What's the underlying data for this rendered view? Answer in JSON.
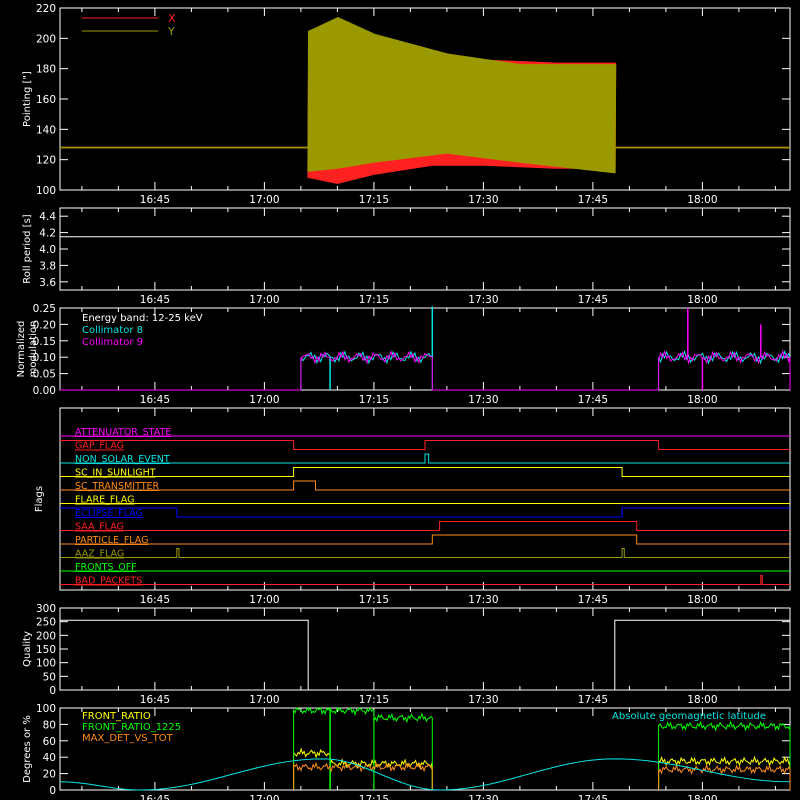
{
  "time_ticks": [
    "16:45",
    "17:00",
    "17:15",
    "17:30",
    "17:45",
    "18:00"
  ],
  "colors": {
    "background": "#000000",
    "axis": "#ffffff",
    "red": "#ff2020",
    "olive": "#9a9a00",
    "cyan": "#00e5e5",
    "magenta": "#ff00ff",
    "green": "#00ff00",
    "yellow": "#ffff00",
    "orange": "#ff8c1a",
    "blue": "#0000ff"
  },
  "chart_data": [
    {
      "type": "line",
      "ylabel": "Pointing [\"]",
      "ylim": [
        100,
        220
      ],
      "yticks": [
        100,
        120,
        140,
        160,
        180,
        200,
        220
      ],
      "xlim": [
        "16:32",
        "18:12"
      ],
      "legend_position": "top-left",
      "series": [
        {
          "name": "X",
          "color": "red",
          "envelope": [
            [
              "16:32",
              128,
              128
            ],
            [
              "17:06",
              128,
              128
            ],
            [
              "17:06",
              108,
              182
            ],
            [
              "17:10",
              104,
              188
            ],
            [
              "17:15",
              110,
              190
            ],
            [
              "17:23",
              116,
              186
            ],
            [
              "17:30",
              116,
              186
            ],
            [
              "17:40",
              114,
              184
            ],
            [
              "17:48",
              114,
              184
            ],
            [
              "17:48",
              128,
              128
            ],
            [
              "18:12",
              128,
              128
            ]
          ]
        },
        {
          "name": "Y",
          "color": "olive",
          "envelope": [
            [
              "16:32",
              128,
              128
            ],
            [
              "17:06",
              128,
              128
            ],
            [
              "17:06",
              112,
              205
            ],
            [
              "17:10",
              114,
              214
            ],
            [
              "17:15",
              118,
              203
            ],
            [
              "17:25",
              124,
              190
            ],
            [
              "17:35",
              118,
              183
            ],
            [
              "17:48",
              111,
              183
            ],
            [
              "17:48",
              128,
              128
            ],
            [
              "18:12",
              128,
              128
            ]
          ]
        }
      ]
    },
    {
      "type": "line",
      "ylabel": "Roll period [s]",
      "ylim": [
        3.5,
        4.5
      ],
      "yticks": [
        3.6,
        3.8,
        4.0,
        4.2,
        4.4
      ],
      "series": [
        {
          "name": "",
          "color": "axis",
          "x": [
            "16:32",
            "18:12"
          ],
          "y": [
            4.15,
            4.15
          ]
        }
      ]
    },
    {
      "type": "line",
      "ylabel": "Normalized modulation",
      "ylim": [
        0.0,
        0.25
      ],
      "yticks": [
        0.0,
        0.05,
        0.1,
        0.15,
        0.2,
        0.25
      ],
      "annotation": "Energy band: 12-25 keV",
      "legend_position": "top-left",
      "series": [
        {
          "name": "Collimator 8",
          "color": "cyan",
          "segments": [
            [
              "17:05",
              "17:23",
              0.1
            ],
            [
              "17:54",
              "18:12",
              0.1
            ]
          ],
          "spikes": [
            [
              "17:09",
              0.0
            ],
            [
              "17:23",
              0.26
            ]
          ]
        },
        {
          "name": "Collimator 9",
          "color": "magenta",
          "segments": [
            [
              "17:05",
              "17:23",
              0.1
            ],
            [
              "17:54",
              "18:12",
              0.1
            ]
          ],
          "spikes": [
            [
              "17:58",
              0.25
            ],
            [
              "18:00",
              0.0
            ],
            [
              "18:08",
              0.2
            ]
          ]
        }
      ]
    },
    {
      "type": "line",
      "ylabel": "Flags",
      "series": [
        {
          "name": "ATTENUATOR_STATE",
          "color": "magenta",
          "steps": [
            [
              "16:32",
              0
            ],
            [
              "18:12",
              0
            ]
          ]
        },
        {
          "name": "SAA_FLAG_GAP_FLAG",
          "label": "GAP_FLAG",
          "color": "red",
          "steps": [
            [
              "16:32",
              1
            ],
            [
              "17:04",
              0
            ],
            [
              "17:22",
              1
            ],
            [
              "17:54",
              0
            ],
            [
              "18:12",
              0
            ]
          ]
        },
        {
          "name": "NON_SOLAR_EVENT",
          "color": "cyan",
          "steps": [
            [
              "16:32",
              0
            ],
            [
              "17:22",
              1
            ],
            [
              "17:22.5",
              0
            ],
            [
              "18:12",
              0
            ]
          ]
        },
        {
          "name": "SC_IN_SUNLIGHT",
          "color": "yellow",
          "steps": [
            [
              "16:32",
              0
            ],
            [
              "17:04",
              1
            ],
            [
              "17:49",
              0
            ],
            [
              "18:12",
              0
            ]
          ]
        },
        {
          "name": "SC_TRANSMITTER",
          "color": "orange",
          "steps": [
            [
              "16:32",
              0
            ],
            [
              "17:04",
              1
            ],
            [
              "17:07",
              0
            ],
            [
              "18:12",
              0
            ]
          ]
        },
        {
          "name": "FLARE_FLAG",
          "color": "yellow",
          "steps": [
            [
              "16:32",
              0
            ],
            [
              "18:12",
              0
            ]
          ]
        },
        {
          "name": "ECLIPSE_FLAG",
          "color": "blue",
          "steps": [
            [
              "16:32",
              1
            ],
            [
              "16:48",
              0
            ],
            [
              "17:49",
              1
            ],
            [
              "18:12",
              1
            ]
          ]
        },
        {
          "name": "SAA_FLAG",
          "color": "red",
          "steps": [
            [
              "16:32",
              0
            ],
            [
              "17:24",
              1
            ],
            [
              "17:51",
              0
            ],
            [
              "18:12",
              0
            ]
          ]
        },
        {
          "name": "PARTICLE_FLAG",
          "color": "orange",
          "steps": [
            [
              "16:32",
              0
            ],
            [
              "17:23",
              1
            ],
            [
              "17:51",
              0
            ],
            [
              "18:12",
              0
            ]
          ]
        },
        {
          "name": "AAZ_FLAG",
          "color": "olive",
          "steps": [
            [
              "16:32",
              0
            ],
            [
              "16:48",
              1
            ],
            [
              "16:48.3",
              0
            ],
            [
              "17:49",
              1
            ],
            [
              "17:49.3",
              0
            ],
            [
              "18:12",
              0
            ]
          ]
        },
        {
          "name": "FRONTS_OFF",
          "color": "green",
          "steps": [
            [
              "16:32",
              0
            ],
            [
              "18:12",
              0
            ]
          ]
        },
        {
          "name": "BAD_PACKETS",
          "color": "red",
          "steps": [
            [
              "16:32",
              0
            ],
            [
              "18:08",
              1
            ],
            [
              "18:08.2",
              0
            ],
            [
              "18:12",
              0
            ]
          ]
        }
      ],
      "labels": [
        "ATTENUATOR_STATE",
        "GAP_FLAG",
        "NON_SOLAR_EVENT",
        "SC_IN_SUNLIGHT",
        "SC_TRANSMITTER",
        "FLARE_FLAG",
        "ECLIPSE_FLAG",
        "SAA_FLAG",
        "PARTICLE_FLAG",
        "AAZ_FLAG",
        "FRONTS_OFF",
        "BAD_PACKETS"
      ]
    },
    {
      "type": "line",
      "ylabel": "Quality",
      "ylim": [
        0,
        300
      ],
      "yticks": [
        0,
        50,
        100,
        150,
        200,
        250,
        300
      ],
      "series": [
        {
          "name": "",
          "color": "axis",
          "x": [
            "16:32",
            "17:06",
            "17:06",
            "17:48",
            "17:48",
            "18:12"
          ],
          "y": [
            255,
            255,
            0,
            0,
            255,
            255
          ]
        }
      ]
    },
    {
      "type": "line",
      "ylabel": "Degrees or %",
      "ylim": [
        0,
        100
      ],
      "yticks": [
        0,
        20,
        40,
        60,
        80,
        100
      ],
      "legend_position": "top",
      "series": [
        {
          "name": "FRONT_RATIO",
          "color": "yellow",
          "segments": [
            [
              "17:04",
              "17:09",
              45
            ],
            [
              "17:09",
              "17:23",
              32
            ],
            [
              "17:54",
              "18:12",
              35
            ]
          ]
        },
        {
          "name": "FRONT_RATIO_1225",
          "color": "green",
          "segments": [
            [
              "17:04",
              "17:15",
              97
            ],
            [
              "17:15",
              "17:23",
              88
            ],
            [
              "17:54",
              "18:12",
              78
            ]
          ],
          "spikes": [
            [
              "17:09",
              0
            ]
          ]
        },
        {
          "name": "MAX_DET_VS_TOT",
          "color": "orange",
          "segments": [
            [
              "17:04",
              "17:23",
              28
            ],
            [
              "17:54",
              "18:12",
              25
            ]
          ]
        },
        {
          "name": "Absolute geomagnetic latitude",
          "color": "cyan",
          "x": [
            "16:32",
            "16:43",
            "17:08",
            "17:24",
            "17:48",
            "18:12"
          ],
          "y": [
            10,
            0,
            38,
            0,
            38,
            10
          ]
        }
      ]
    }
  ]
}
